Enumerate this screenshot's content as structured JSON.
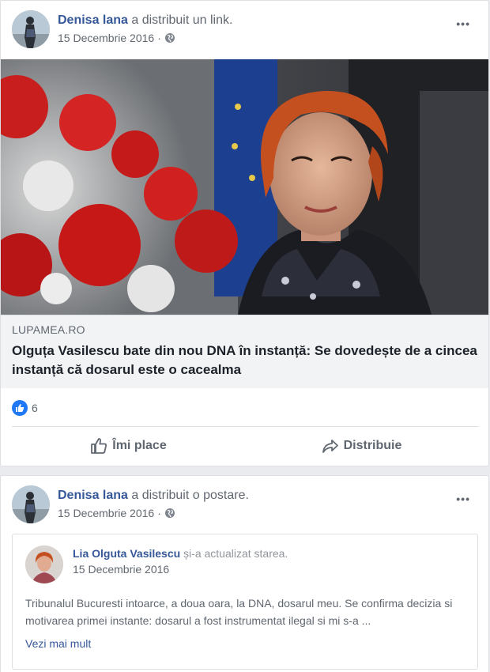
{
  "post1": {
    "author": "Denisa lana",
    "action_text": " a distribuit un link.",
    "date": "15 Decembrie 2016",
    "dot": "·",
    "more": "•••",
    "link": {
      "domain": "LUPAMEA.RO",
      "title": "Olguța Vasilescu bate din nou DNA în instanță: Se dovedește de a cincea instanță că dosarul este o cacealma"
    },
    "reaction_count": "6",
    "actions": {
      "like": "Îmi place",
      "share": "Distribuie"
    }
  },
  "post2": {
    "author": "Denisa lana",
    "action_text": " a distribuit o postare.",
    "date": "15 Decembrie 2016",
    "dot": "·",
    "more": "•••",
    "shared": {
      "author": "Lia Olguta Vasilescu",
      "action_text": " și-a actualizat starea.",
      "date": "15 Decembrie 2016",
      "text": "Tribunalul Bucuresti intoarce, a doua oara, la DNA, dosarul meu. Se confirma decizia si motivarea primei instante: dosarul a fost instrumentat ilegal si mi s-a ...",
      "see_more": "Vezi mai mult"
    }
  },
  "colors": {
    "link_blue": "#365899",
    "like_blue": "#2078f4",
    "meta_gray": "#606770"
  }
}
